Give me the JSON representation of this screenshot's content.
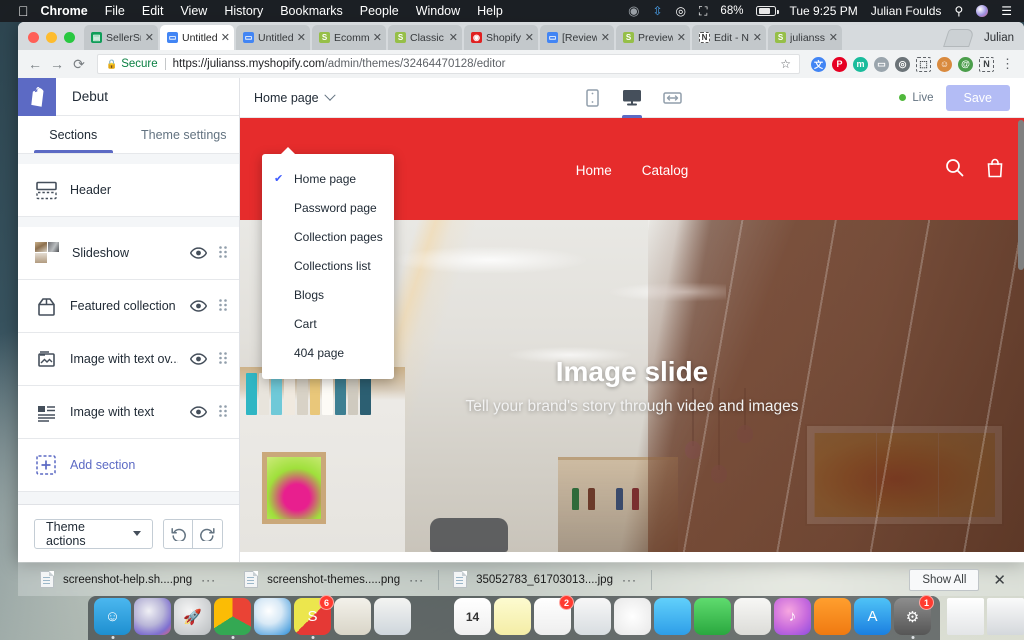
{
  "menubar": {
    "apple": "",
    "items": [
      "Chrome",
      "File",
      "Edit",
      "View",
      "History",
      "Bookmarks",
      "People",
      "Window",
      "Help"
    ],
    "status": {
      "creative_cloud": "creative-cloud-icon",
      "bluetooth": "⌁",
      "wifi": "wifi-icon",
      "airplay": "airplay-icon",
      "battery_percent": "68%",
      "clock": "Tue 9:25 PM",
      "user": "Julian Foulds",
      "search": "search-icon",
      "siri": "siri-icon",
      "notifications": "notification-center-icon"
    }
  },
  "browser": {
    "tabs": [
      {
        "title": "SellerSmi",
        "favicon": "sheets-icon",
        "fav_color": "#0f9d58",
        "fav_char": "▤",
        "active": false
      },
      {
        "title": "Untitled d",
        "favicon": "slides-icon",
        "fav_color": "#4285f4",
        "fav_char": "▭",
        "active": true
      },
      {
        "title": "Untitled d",
        "favicon": "slides-icon",
        "fav_color": "#4285f4",
        "fav_char": "▭",
        "active": false
      },
      {
        "title": "Ecommer",
        "favicon": "shopify-icon",
        "fav_color": "#96bf48",
        "fav_char": "S",
        "active": false
      },
      {
        "title": "Classic Th",
        "favicon": "shopify-icon",
        "fav_color": "#96bf48",
        "fav_char": "S",
        "active": false
      },
      {
        "title": "Shopify B",
        "favicon": "shopify-blog-icon",
        "fav_color": "#e02020",
        "fav_char": "◉",
        "active": false
      },
      {
        "title": "[Review] E",
        "favicon": "slides-icon",
        "fav_color": "#4285f4",
        "fav_char": "▭",
        "active": false
      },
      {
        "title": "Preview C",
        "favicon": "shopify-icon",
        "fav_color": "#96bf48",
        "fav_char": "S",
        "active": false
      },
      {
        "title": "Edit - Nim",
        "favicon": "nimbus-icon",
        "fav_color": "#ffffff",
        "fav_char": "N",
        "active": false
      },
      {
        "title": "julianss ~~",
        "favicon": "shopify-icon",
        "fav_color": "#96bf48",
        "fav_char": "S",
        "active": false
      }
    ],
    "new_tab": "new-tab-button",
    "window_user": "Julian",
    "nav": {
      "back": "←",
      "forward": "→",
      "reload": "⟳"
    },
    "omnibox": {
      "lock": "🔒",
      "secure_label": "Secure",
      "url_strong": "https://julianss.myshopify.com",
      "url_dim": "/admin/themes/32464470128/editor",
      "star": "☆"
    },
    "extensions": [
      {
        "name": "google-translate-ext",
        "color": "#4285f4",
        "char": "文"
      },
      {
        "name": "pinterest-ext",
        "color": "#e60023",
        "char": "P"
      },
      {
        "name": "mailtrack-ext",
        "color": "#1abc9c",
        "char": "m"
      },
      {
        "name": "screencast-ext",
        "color": "#9aa5ad",
        "char": "▭"
      },
      {
        "name": "film-ext",
        "color": "#6b7378",
        "char": "◎"
      },
      {
        "name": "screen-capture-ext",
        "color": "#2ecc40",
        "char": "⬚"
      },
      {
        "name": "emoji-ext",
        "color": "#d98a3e",
        "char": "☺"
      },
      {
        "name": "evernote-ext",
        "color": "#4b9e4b",
        "char": "@"
      },
      {
        "name": "nimbus-ext",
        "color": "#5a6268",
        "char": "N"
      }
    ],
    "menu": "⋮"
  },
  "editor": {
    "theme_name": "Debut",
    "logo": "shopify-bag-icon",
    "tabs": [
      {
        "label": "Sections",
        "active": true
      },
      {
        "label": "Theme settings",
        "active": false
      }
    ],
    "sections": [
      {
        "label": "Header",
        "icon": "header-icon",
        "has_eye": false,
        "has_drag": false
      },
      {
        "label": "Slideshow",
        "icon": "slideshow-thumbnails",
        "has_eye": true,
        "has_drag": true
      },
      {
        "label": "Featured collection",
        "icon": "collection-icon",
        "has_eye": true,
        "has_drag": true
      },
      {
        "label": "Image with text ov...",
        "icon": "image-text-overlay-icon",
        "has_eye": true,
        "has_drag": true
      },
      {
        "label": "Image with text",
        "icon": "image-with-text-icon",
        "has_eye": true,
        "has_drag": true
      }
    ],
    "add_section": "Add section",
    "add_section_icon": "add-section-icon",
    "footer": {
      "theme_actions": "Theme actions",
      "undo": "undo-icon",
      "redo": "redo-icon"
    },
    "toolbar": {
      "page_selector": "Home page",
      "devices": [
        {
          "name": "mobile-view",
          "active": false
        },
        {
          "name": "desktop-view",
          "active": true
        },
        {
          "name": "fullscreen-view",
          "active": false
        }
      ],
      "live_label": "Live",
      "save_label": "Save"
    },
    "page_menu": [
      {
        "label": "Home page",
        "checked": true
      },
      {
        "label": "Password page",
        "checked": false
      },
      {
        "label": "Collection pages",
        "checked": false
      },
      {
        "label": "Collections list",
        "checked": false
      },
      {
        "label": "Blogs",
        "checked": false
      },
      {
        "label": "Cart",
        "checked": false
      },
      {
        "label": "404 page",
        "checked": false
      }
    ]
  },
  "storefront": {
    "header_color": "#e62c2c",
    "nav": [
      "Home",
      "Catalog"
    ],
    "icons": {
      "search": "search-icon",
      "cart": "cart-icon"
    },
    "hero": {
      "heading": "Image slide",
      "subheading": "Tell your brand's story through video and images"
    }
  },
  "downloads": {
    "items": [
      {
        "name": "screenshot-help.sh....png",
        "more": "···"
      },
      {
        "name": "screenshot-themes.....png",
        "more": "···"
      },
      {
        "name": "35052783_61703013....jpg",
        "more": "···"
      }
    ],
    "show_all": "Show All",
    "close": "✕"
  },
  "dock": {
    "apps": [
      {
        "name": "finder",
        "char": "☺",
        "bg": "linear-gradient(180deg,#4bb7ef,#1e8fd0)",
        "running": true
      },
      {
        "name": "siri",
        "char": "",
        "bg": "radial-gradient(circle at 40% 35%,#f0f0f5,#b9b6d8 45%,#7e6fd0 75%,#e0627f)",
        "running": false
      },
      {
        "name": "launchpad",
        "char": "🚀",
        "bg": "radial-gradient(circle at 40% 35%,#f5f5f5,#b9bdc0)",
        "running": false
      },
      {
        "name": "google-chrome",
        "char": "",
        "bg": "conic-gradient(#ea4335 0 33%,#34a853 33% 66%,#fbbc05 66% 100%)",
        "running": true
      },
      {
        "name": "safari",
        "char": "",
        "bg": "radial-gradient(circle at 40% 35%,#ffffff,#d8e9f6 40%,#2b8ed8)",
        "running": false
      },
      {
        "name": "slack",
        "char": "S",
        "bg": "linear-gradient(135deg,#ece64d 0 50%,#e53935 50% 100%)",
        "running": true,
        "badge": "6"
      },
      {
        "name": "numbers",
        "char": "",
        "bg": "linear-gradient(180deg,#f3f1ea,#d9d5c8)",
        "running": false
      },
      {
        "name": "mail",
        "char": "",
        "bg": "linear-gradient(180deg,#f4f4f2,#cfd6dc)",
        "running": false
      },
      {
        "name": "contacts",
        "char": "",
        "bg": "linear-gradient(180deg,#c09a6b,#9a7games)",
        "running": false
      },
      {
        "name": "calendar",
        "char": "14",
        "bg": "linear-gradient(180deg,#ffffff,#f0f0f0)",
        "running": false
      },
      {
        "name": "notes",
        "char": "",
        "bg": "linear-gradient(180deg,#fdfbd0,#f4eda6)",
        "running": false
      },
      {
        "name": "reminders",
        "char": "",
        "bg": "linear-gradient(180deg,#ffffff,#eeeeee)",
        "running": false,
        "badge": "2"
      },
      {
        "name": "news",
        "char": "",
        "bg": "linear-gradient(180deg,#f7f7f7,#d8dde1)",
        "running": false
      },
      {
        "name": "photos",
        "char": "",
        "bg": "radial-gradient(circle at 50% 50%,#ffffff,#e8e8e8)",
        "running": false
      },
      {
        "name": "messages",
        "char": "",
        "bg": "linear-gradient(180deg,#61d0fb,#2e9ee8)",
        "running": false
      },
      {
        "name": "facetime",
        "char": "",
        "bg": "linear-gradient(180deg,#5fdb6e,#2aa83f)",
        "running": false
      },
      {
        "name": "keynote-charts",
        "char": "",
        "bg": "linear-gradient(180deg,#f7f7f5,#dcdcd8)",
        "running": false
      },
      {
        "name": "itunes",
        "char": "♪",
        "bg": "radial-gradient(circle at 40% 35%,#f7a6e0,#c86bdd 55%,#8e4ce0)",
        "running": false
      },
      {
        "name": "ibooks",
        "char": "",
        "bg": "linear-gradient(180deg,#ff9f2e,#f07a11)",
        "running": false
      },
      {
        "name": "app-store",
        "char": "A",
        "bg": "linear-gradient(180deg,#4fc3f7,#1b7fe0)",
        "running": false
      },
      {
        "name": "system-preferences",
        "char": "⚙",
        "bg": "linear-gradient(180deg,#8d8d8d,#565656)",
        "running": true,
        "badge": "1"
      }
    ],
    "stack_items": [
      {
        "name": "document-stack",
        "char": ""
      },
      {
        "name": "downloads-stack",
        "char": ""
      },
      {
        "name": "screenshots-stack",
        "char": ""
      },
      {
        "name": "files-stack",
        "char": ""
      },
      {
        "name": "trash",
        "char": ""
      }
    ]
  }
}
